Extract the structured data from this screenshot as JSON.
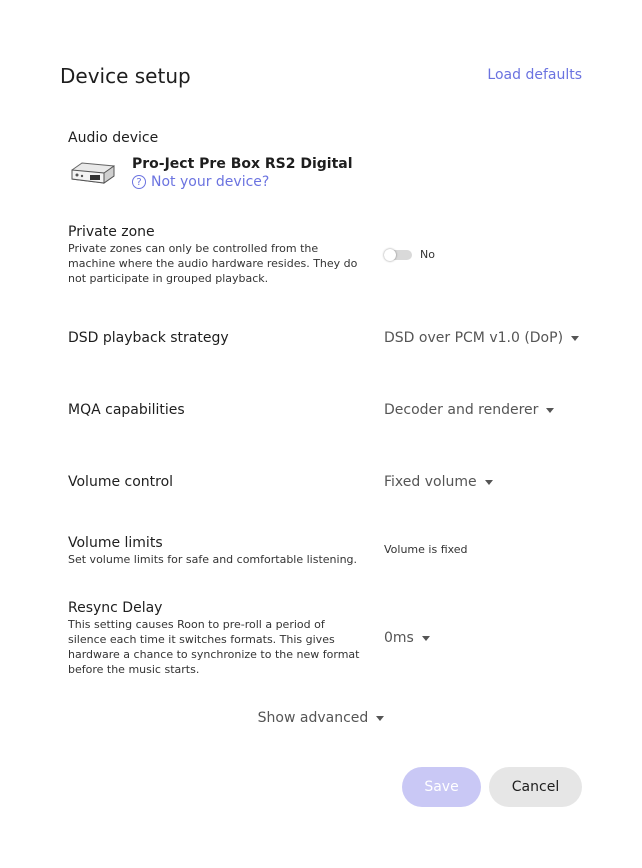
{
  "header": {
    "title": "Device setup",
    "load_defaults": "Load defaults"
  },
  "audio_device": {
    "label": "Audio device",
    "name": "Pro-Ject Pre Box RS2 Digital",
    "help_icon": "?",
    "not_your_device": "Not your device?"
  },
  "private_zone": {
    "label": "Private zone",
    "description": "Private zones can only be controlled from the machine where the audio hardware resides. They do not participate in grouped playback.",
    "toggle_state": "No"
  },
  "dsd": {
    "label": "DSD playback strategy",
    "value": "DSD over PCM v1.0 (DoP)"
  },
  "mqa": {
    "label": "MQA capabilities",
    "value": "Decoder and renderer"
  },
  "volume_control": {
    "label": "Volume control",
    "value": "Fixed volume"
  },
  "volume_limits": {
    "label": "Volume limits",
    "description": "Set volume limits for safe and comfortable listening.",
    "value": "Volume is fixed"
  },
  "resync": {
    "label": "Resync Delay",
    "description": "This setting causes Roon to pre-roll a period of silence each time it switches formats. This gives hardware a chance to synchronize to the new format before the music starts.",
    "value": "0ms"
  },
  "advanced": {
    "label": "Show advanced"
  },
  "footer": {
    "save_label": "Save",
    "cancel_label": "Cancel"
  },
  "colors": {
    "accent": "#6b73e0",
    "save_bg": "#c9c8f5",
    "cancel_bg": "#e6e6e6"
  }
}
